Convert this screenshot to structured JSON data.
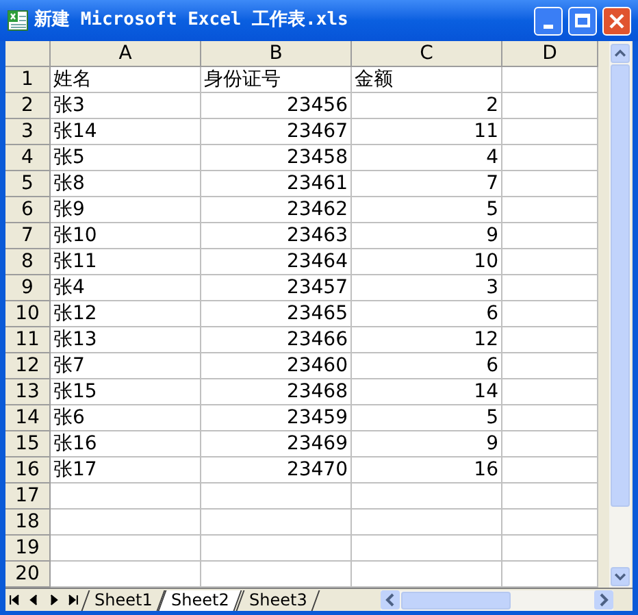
{
  "window": {
    "title": "新建 Microsoft Excel 工作表.xls"
  },
  "columns": [
    "A",
    "B",
    "C",
    "D"
  ],
  "rows": [
    {
      "number": "1",
      "cells": [
        {
          "text": "姓名",
          "kind": "text"
        },
        {
          "text": "身份证号",
          "kind": "text"
        },
        {
          "text": "金额",
          "kind": "text"
        }
      ]
    },
    {
      "number": "2",
      "cells": [
        {
          "text": "张3",
          "kind": "text"
        },
        {
          "text": "23456",
          "kind": "number"
        },
        {
          "text": "2",
          "kind": "number"
        }
      ]
    },
    {
      "number": "3",
      "cells": [
        {
          "text": "张14",
          "kind": "text"
        },
        {
          "text": "23467",
          "kind": "number"
        },
        {
          "text": "11",
          "kind": "number"
        }
      ]
    },
    {
      "number": "4",
      "cells": [
        {
          "text": "张5",
          "kind": "text"
        },
        {
          "text": "23458",
          "kind": "number"
        },
        {
          "text": "4",
          "kind": "number"
        }
      ]
    },
    {
      "number": "5",
      "cells": [
        {
          "text": "张8",
          "kind": "text"
        },
        {
          "text": "23461",
          "kind": "number"
        },
        {
          "text": "7",
          "kind": "number"
        }
      ]
    },
    {
      "number": "6",
      "cells": [
        {
          "text": "张9",
          "kind": "text"
        },
        {
          "text": "23462",
          "kind": "number"
        },
        {
          "text": "5",
          "kind": "number"
        }
      ]
    },
    {
      "number": "7",
      "cells": [
        {
          "text": "张10",
          "kind": "text"
        },
        {
          "text": "23463",
          "kind": "number"
        },
        {
          "text": "9",
          "kind": "number"
        }
      ]
    },
    {
      "number": "8",
      "cells": [
        {
          "text": "张11",
          "kind": "text"
        },
        {
          "text": "23464",
          "kind": "number"
        },
        {
          "text": "10",
          "kind": "number"
        }
      ]
    },
    {
      "number": "9",
      "cells": [
        {
          "text": "张4",
          "kind": "text"
        },
        {
          "text": "23457",
          "kind": "number"
        },
        {
          "text": "3",
          "kind": "number"
        }
      ]
    },
    {
      "number": "10",
      "cells": [
        {
          "text": "张12",
          "kind": "text"
        },
        {
          "text": "23465",
          "kind": "number"
        },
        {
          "text": "6",
          "kind": "number"
        }
      ]
    },
    {
      "number": "11",
      "cells": [
        {
          "text": "张13",
          "kind": "text"
        },
        {
          "text": "23466",
          "kind": "number"
        },
        {
          "text": "12",
          "kind": "number"
        }
      ]
    },
    {
      "number": "12",
      "cells": [
        {
          "text": "张7",
          "kind": "text"
        },
        {
          "text": "23460",
          "kind": "number"
        },
        {
          "text": "6",
          "kind": "number"
        }
      ]
    },
    {
      "number": "13",
      "cells": [
        {
          "text": "张15",
          "kind": "text"
        },
        {
          "text": "23468",
          "kind": "number"
        },
        {
          "text": "14",
          "kind": "number"
        }
      ]
    },
    {
      "number": "14",
      "cells": [
        {
          "text": "张6",
          "kind": "text"
        },
        {
          "text": "23459",
          "kind": "number"
        },
        {
          "text": "5",
          "kind": "number"
        }
      ]
    },
    {
      "number": "15",
      "cells": [
        {
          "text": "张16",
          "kind": "text"
        },
        {
          "text": "23469",
          "kind": "number"
        },
        {
          "text": "9",
          "kind": "number"
        }
      ]
    },
    {
      "number": "16",
      "cells": [
        {
          "text": "张17",
          "kind": "text"
        },
        {
          "text": "23470",
          "kind": "number"
        },
        {
          "text": "16",
          "kind": "number"
        }
      ]
    },
    {
      "number": "17",
      "cells": []
    },
    {
      "number": "18",
      "cells": []
    },
    {
      "number": "19",
      "cells": []
    },
    {
      "number": "20",
      "cells": []
    }
  ],
  "sheet_tabs": [
    {
      "label": "Sheet1",
      "selected": false
    },
    {
      "label": "Sheet2",
      "selected": true
    },
    {
      "label": "Sheet3",
      "selected": false
    }
  ]
}
